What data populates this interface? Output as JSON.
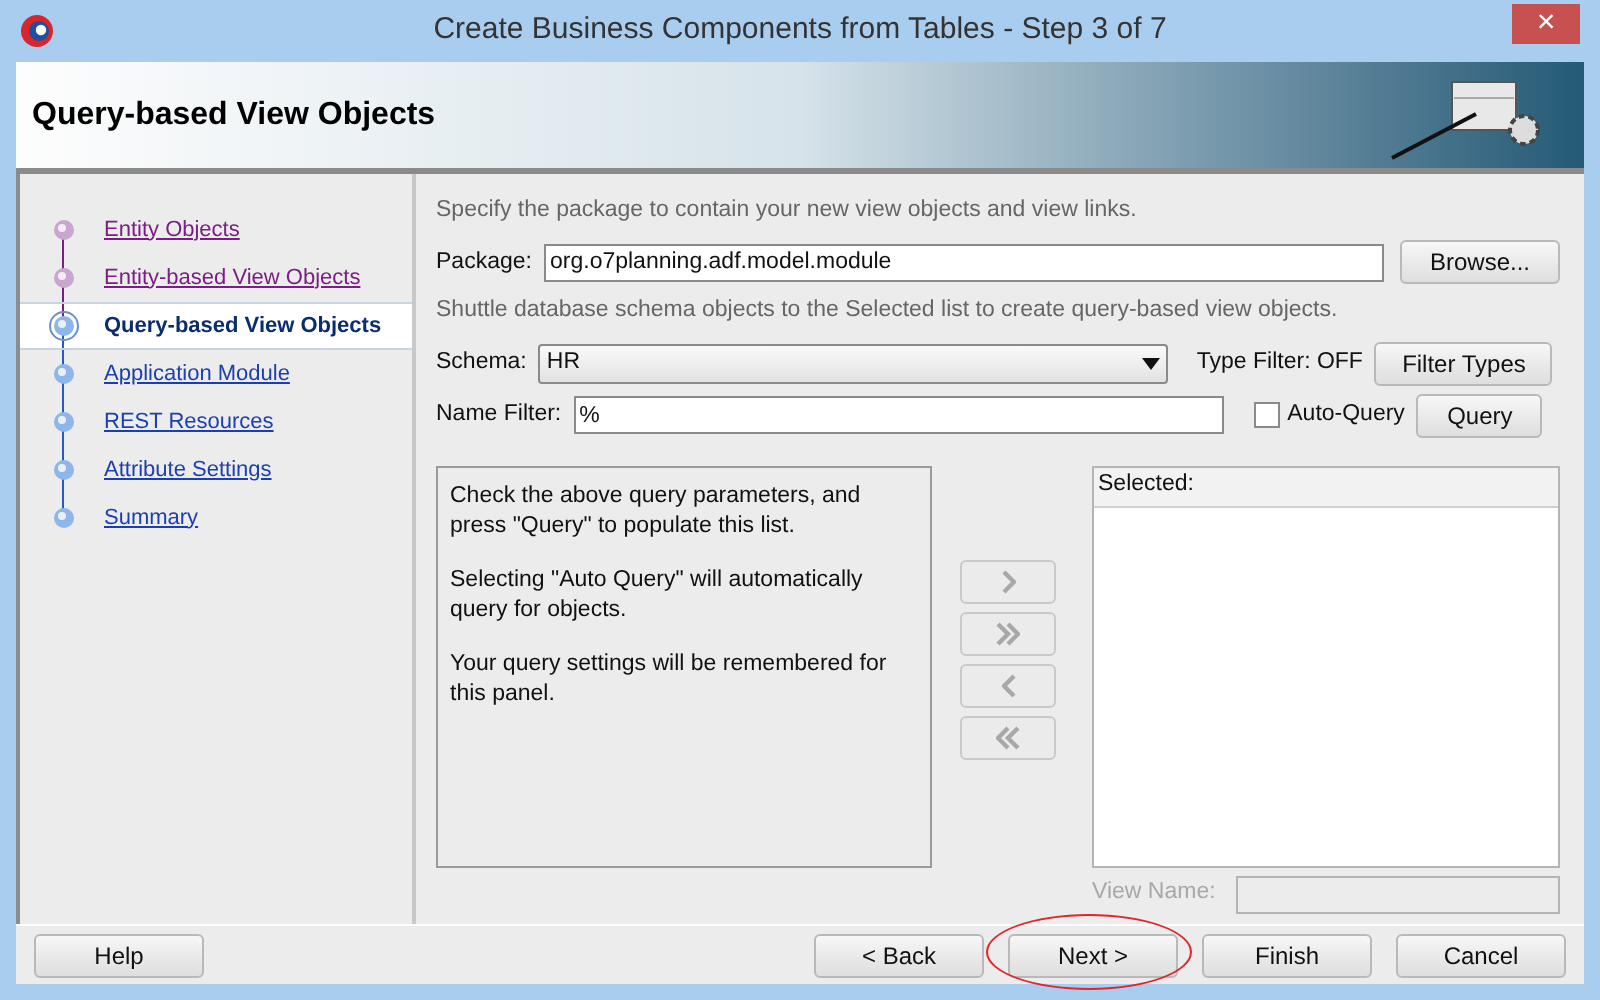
{
  "window": {
    "title": "Create Business Components from Tables - Step 3 of 7",
    "close": "×"
  },
  "header": {
    "title": "Query-based View Objects"
  },
  "steps": [
    {
      "label": "Entity Objects",
      "visited": true,
      "selected": false
    },
    {
      "label": "Entity-based View Objects",
      "visited": true,
      "selected": false
    },
    {
      "label": "Query-based View Objects",
      "visited": true,
      "selected": true
    },
    {
      "label": "Application Module",
      "visited": false,
      "selected": false
    },
    {
      "label": "REST Resources",
      "visited": false,
      "selected": false
    },
    {
      "label": "Attribute Settings",
      "visited": false,
      "selected": false
    },
    {
      "label": "Summary",
      "visited": false,
      "selected": false
    }
  ],
  "package": {
    "intro": "Specify the package to contain your new view objects and view links.",
    "label": "Package:",
    "value": "org.o7planning.adf.model.module",
    "button": "Browse..."
  },
  "shuttle_intro": "Shuttle database schema objects to the Selected list to create query-based view objects.",
  "schema": {
    "label": "Schema:",
    "value": "HR",
    "type_filter": "Type Filter: OFF",
    "button": "Filter Types"
  },
  "name_filter": {
    "label": "Name Filter:",
    "value": "%",
    "auto_query": {
      "label": "Auto-Query",
      "checked": false
    },
    "button": "Query"
  },
  "available_notes": [
    "Check the above query parameters, and press \"Query\" to populate this list.",
    "Selecting \"Auto Query\" will automatically query for objects.",
    "Your query settings will be remembered for this panel."
  ],
  "shuttle_buttons": [
    {
      "kind": "add",
      "disabled": true
    },
    {
      "kind": "add_all",
      "disabled": true
    },
    {
      "kind": "remove",
      "disabled": true
    },
    {
      "kind": "remove_all",
      "disabled": true
    }
  ],
  "selected_list": {
    "header": "Selected:"
  },
  "view_name": {
    "label": "View Name:",
    "disabled": true
  },
  "footer": {
    "help": "Help",
    "buttons": [
      {
        "label": "< Back",
        "highlighted": false
      },
      {
        "label": "Next >",
        "highlighted": true
      },
      {
        "label": "Finish",
        "highlighted": false
      },
      {
        "label": "Cancel",
        "highlighted": false
      }
    ]
  }
}
